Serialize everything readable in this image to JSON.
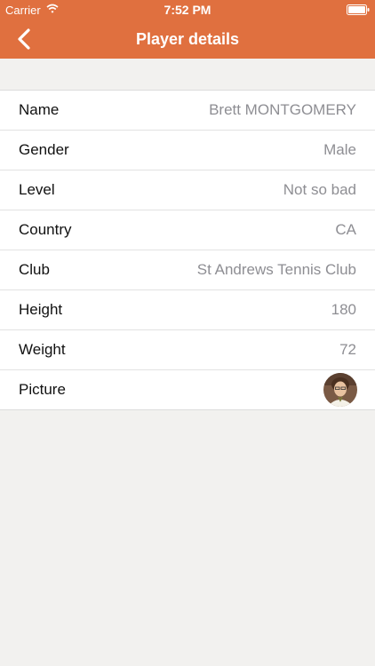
{
  "status_bar": {
    "carrier": "Carrier",
    "time": "7:52 PM"
  },
  "nav": {
    "title": "Player details",
    "back_icon": "chevron-left-icon"
  },
  "details": [
    {
      "label": "Name",
      "value": "Brett MONTGOMERY"
    },
    {
      "label": "Gender",
      "value": "Male"
    },
    {
      "label": "Level",
      "value": "Not so bad"
    },
    {
      "label": "Country",
      "value": "CA"
    },
    {
      "label": "Club",
      "value": "St Andrews Tennis Club"
    },
    {
      "label": "Height",
      "value": "180"
    },
    {
      "label": "Weight",
      "value": "72"
    },
    {
      "label": "Picture",
      "value": ""
    }
  ],
  "colors": {
    "header": "#e0703f",
    "background": "#f2f1ef",
    "value_text": "#8e8e93"
  }
}
